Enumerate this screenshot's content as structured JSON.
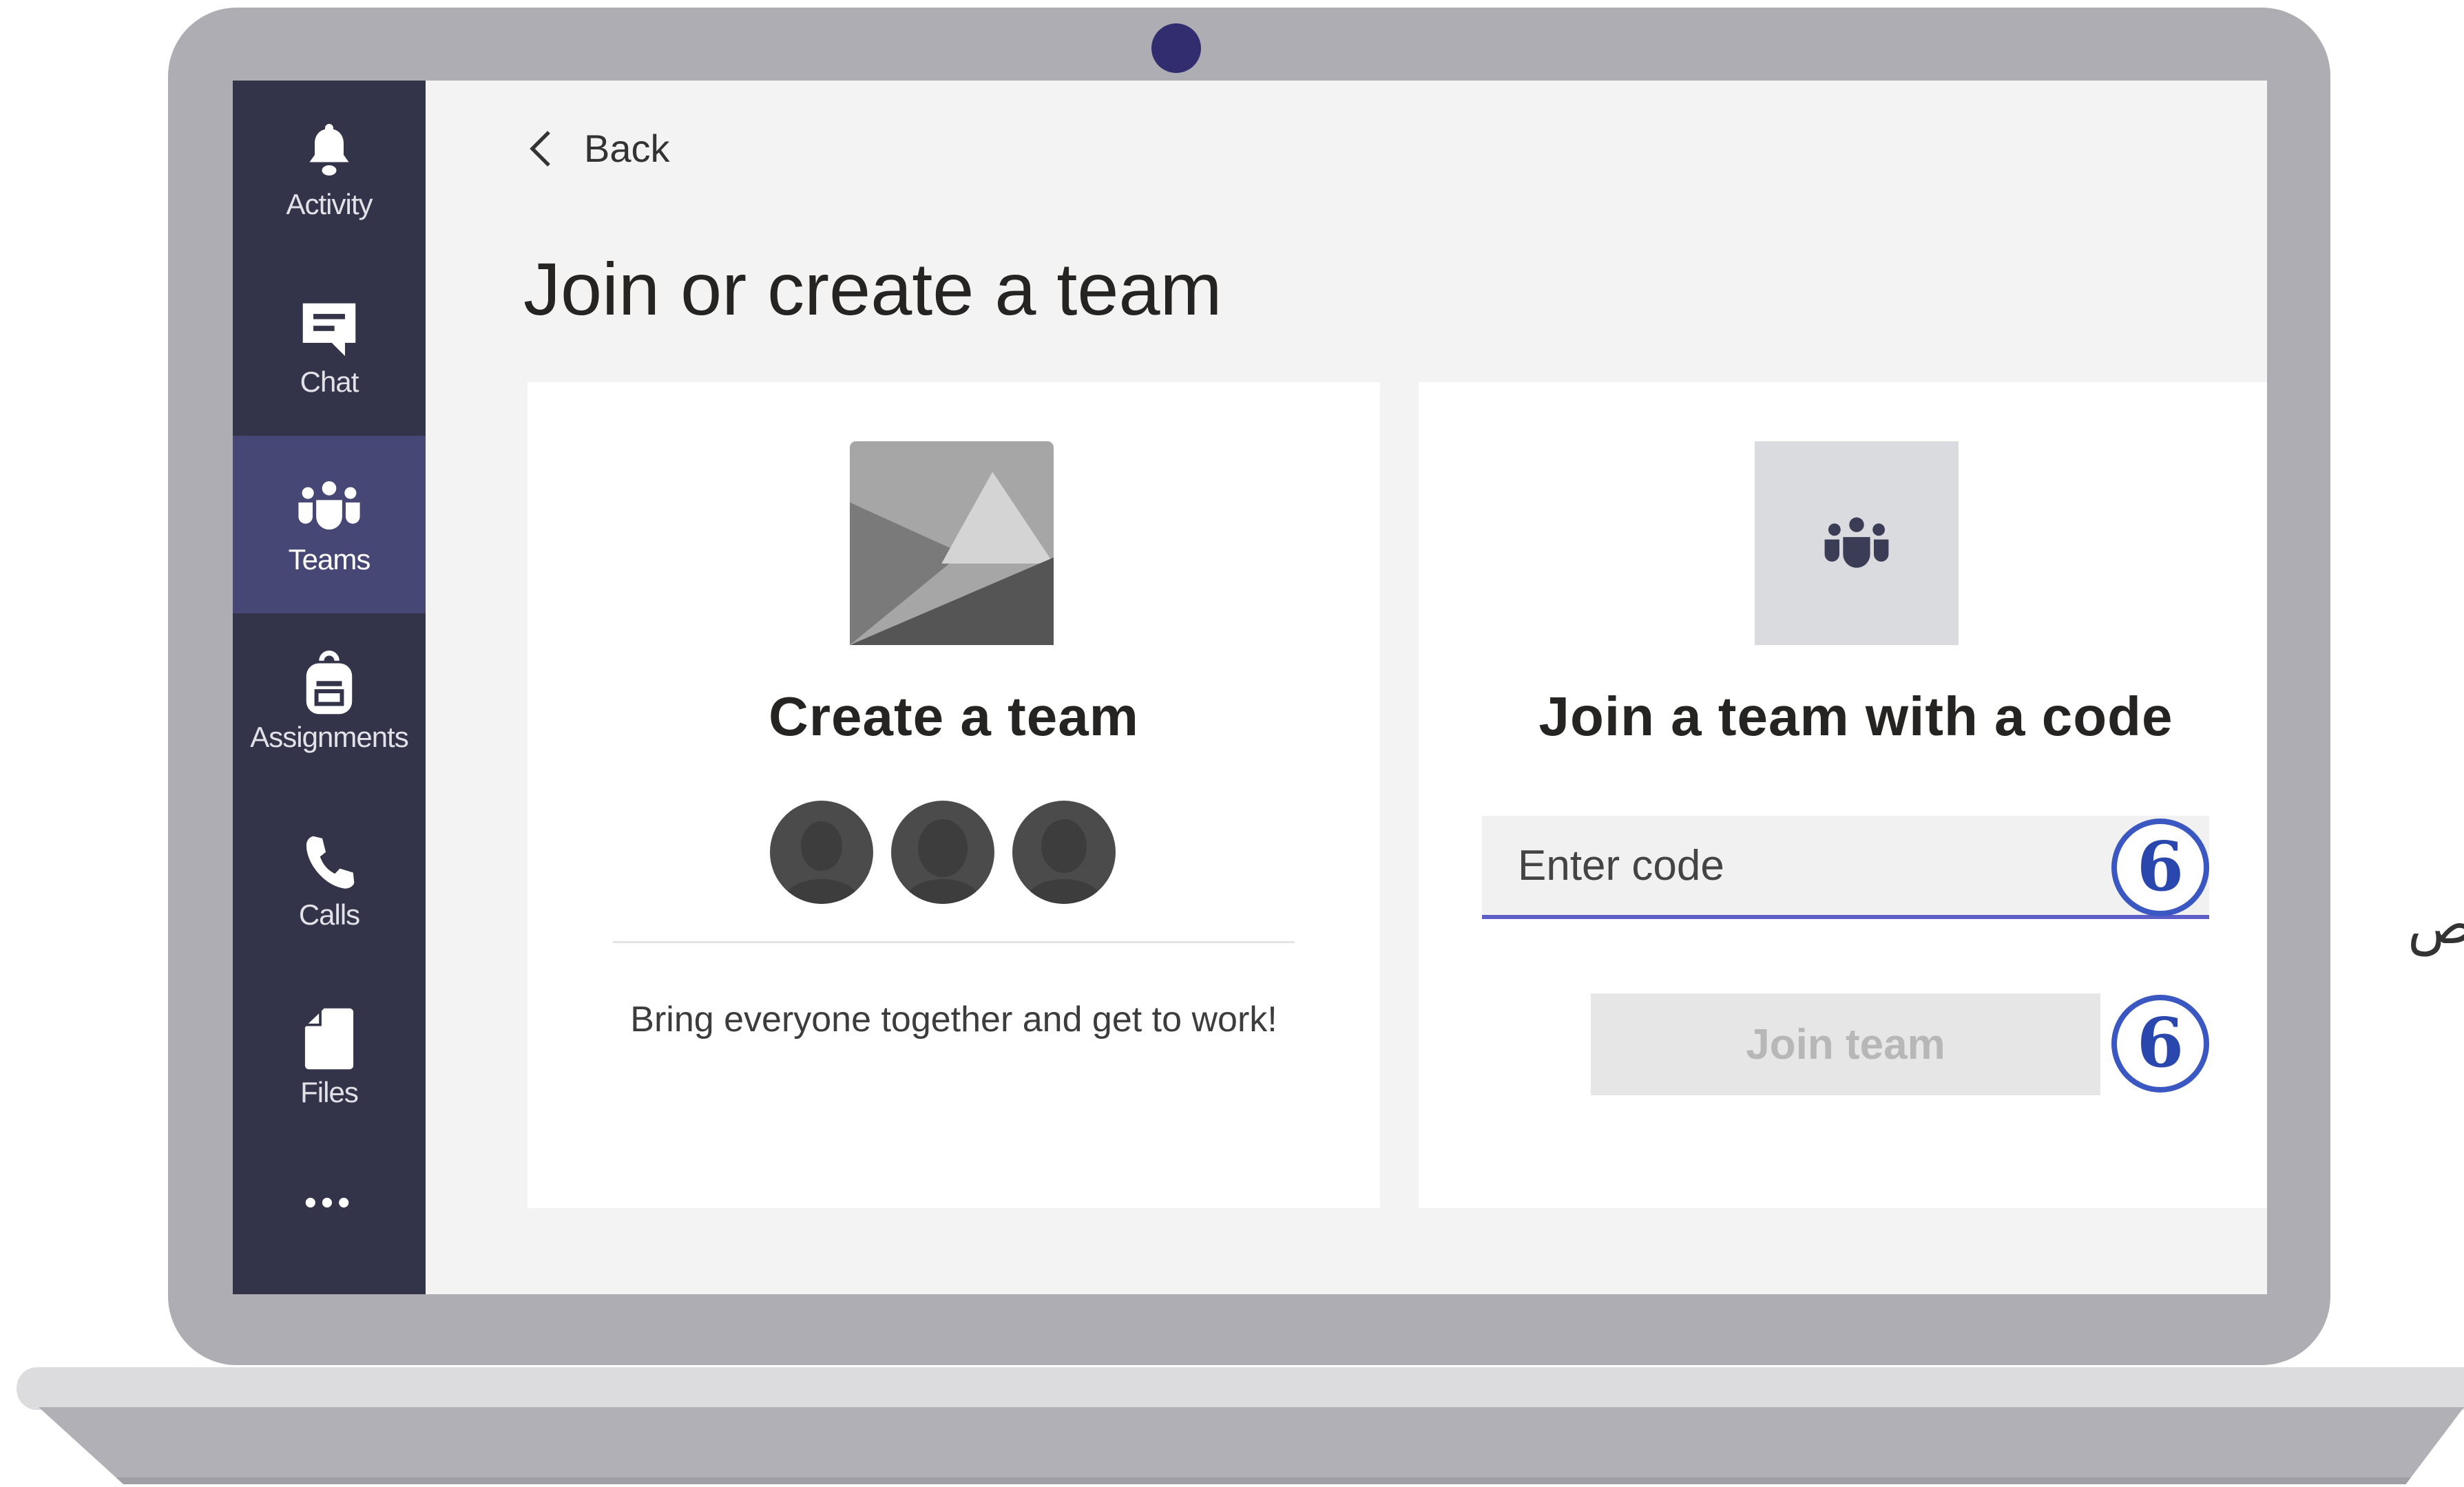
{
  "sidebar": {
    "items": [
      {
        "label": "Activity",
        "icon": "bell-icon"
      },
      {
        "label": "Chat",
        "icon": "chat-icon"
      },
      {
        "label": "Teams",
        "icon": "teams-icon",
        "active": true
      },
      {
        "label": "Assignments",
        "icon": "backpack-icon"
      },
      {
        "label": "Calls",
        "icon": "phone-icon"
      },
      {
        "label": "Files",
        "icon": "file-icon"
      }
    ],
    "more_label": "•••"
  },
  "nav": {
    "back_label": "Back"
  },
  "page": {
    "title": "Join or create a team"
  },
  "create_card": {
    "title": "Create a team",
    "tagline": "Bring everyone together and get to work!"
  },
  "join_card": {
    "title": "Join a team with a code",
    "input_placeholder": "Enter code",
    "button_label": "Join team"
  },
  "annotations": {
    "step_input": "6",
    "step_button": "6"
  },
  "side_text": "ص",
  "colors": {
    "sidebar": "#33344a",
    "sidebar_active": "#464775",
    "accent": "#5b5fc7",
    "badge": "#3a57c2",
    "laptop_frame": "#aeadb4"
  }
}
